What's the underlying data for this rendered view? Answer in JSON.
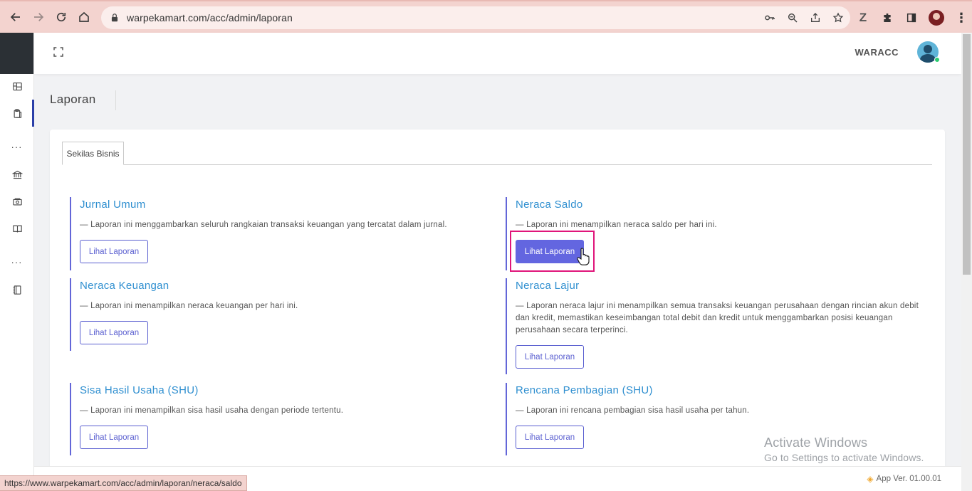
{
  "browser": {
    "url": "warpekamart.com/acc/admin/laporan",
    "status_url": "https://www.warpekamart.com/acc/admin/laporan/neraca/saldo"
  },
  "header": {
    "username": "WARACC"
  },
  "page": {
    "title": "Laporan",
    "tab_label": "Sekilas Bisnis"
  },
  "reports": [
    {
      "title": "Jurnal Umum",
      "desc": "— Laporan ini menggambarkan seluruh rangkaian transaksi keuangan yang tercatat dalam jurnal.",
      "button": "Lihat Laporan"
    },
    {
      "title": "Neraca Saldo",
      "desc": "— Laporan ini menampilkan neraca saldo per hari ini.",
      "button": "Lihat Laporan"
    },
    {
      "title": "Neraca Keuangan",
      "desc": "— Laporan ini menampilkan neraca keuangan per hari ini.",
      "button": "Lihat Laporan"
    },
    {
      "title": "Neraca Lajur",
      "desc": "— Laporan neraca lajur ini menampilkan semua transaksi keuangan perusahaan dengan rincian akun debit dan kredit, memastikan keseimbangan total debit dan kredit untuk menggambarkan posisi keuangan perusahaan secara terperinci.",
      "button": "Lihat Laporan"
    },
    {
      "title": "Sisa Hasil Usaha (SHU)",
      "desc": "— Laporan ini menampilkan sisa hasil usaha dengan periode tertentu.",
      "button": "Lihat Laporan"
    },
    {
      "title": "Rencana Pembagian (SHU)",
      "desc": "— Laporan ini rencana pembagian sisa hasil usaha per tahun.",
      "button": "Lihat Laporan"
    }
  ],
  "footer": {
    "app_version": "App Ver. 01.00.01"
  },
  "watermark": {
    "line1": "Activate Windows",
    "line2": "Go to Settings to activate Windows."
  },
  "colors": {
    "accent": "#6366e0",
    "link": "#2f8fd0",
    "highlight": "#e0157a",
    "sidebar_dark": "#2b3035"
  }
}
